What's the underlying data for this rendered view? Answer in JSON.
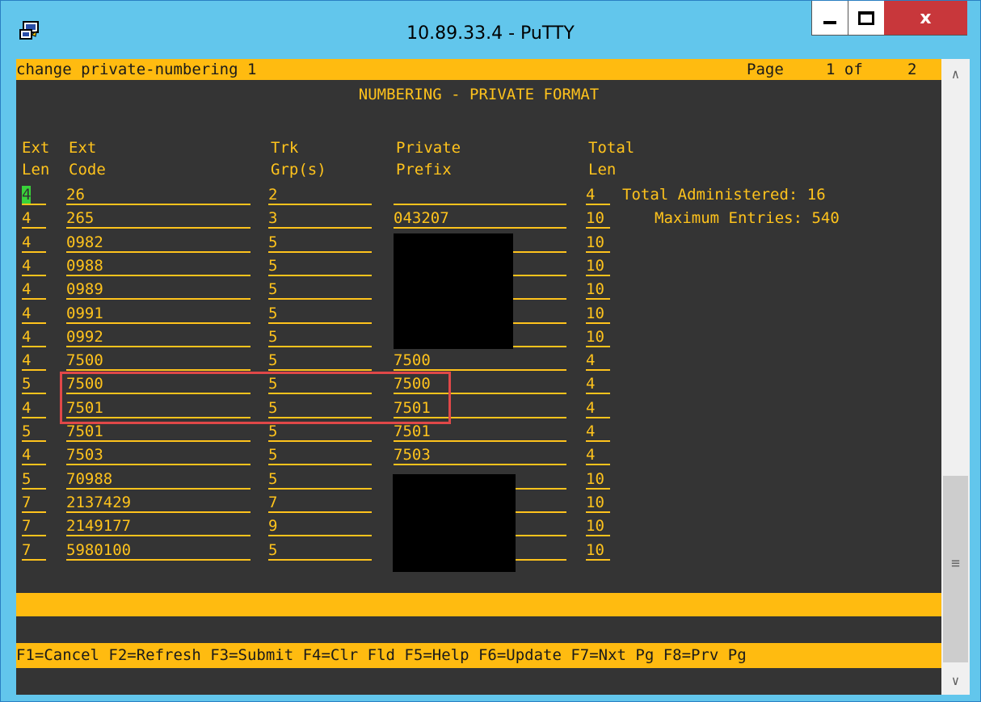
{
  "window": {
    "title": "10.89.33.4 - PuTTY",
    "close_label": "x"
  },
  "terminal": {
    "command": "change private-numbering 1",
    "page_label": "Page",
    "page_current": "1 of",
    "page_total": "2",
    "form_title": "NUMBERING - PRIVATE FORMAT",
    "col_headers": {
      "ext_len_1": "Ext",
      "ext_len_2": "Len",
      "ext_code_1": "Ext",
      "ext_code_2": "Code",
      "trk_1": "Trk",
      "trk_2": "Grp(s)",
      "prefix_1": "Private",
      "prefix_2": "Prefix",
      "total_1": "Total",
      "total_2": "Len"
    },
    "rows": [
      {
        "len": "4",
        "code": "26",
        "trk": "2",
        "prefix": "",
        "total": "4"
      },
      {
        "len": "4",
        "code": "265",
        "trk": "3",
        "prefix": "043207",
        "total": "10"
      },
      {
        "len": "4",
        "code": "0982",
        "trk": "5",
        "prefix": "",
        "total": "10"
      },
      {
        "len": "4",
        "code": "0988",
        "trk": "5",
        "prefix": "",
        "total": "10"
      },
      {
        "len": "4",
        "code": "0989",
        "trk": "5",
        "prefix": "",
        "total": "10"
      },
      {
        "len": "4",
        "code": "0991",
        "trk": "5",
        "prefix": "",
        "total": "10"
      },
      {
        "len": "4",
        "code": "0992",
        "trk": "5",
        "prefix": "",
        "total": "10"
      },
      {
        "len": "4",
        "code": "7500",
        "trk": "5",
        "prefix": "7500",
        "total": "4"
      },
      {
        "len": "5",
        "code": "7500",
        "trk": "5",
        "prefix": "7500",
        "total": "4"
      },
      {
        "len": "4",
        "code": "7501",
        "trk": "5",
        "prefix": "7501",
        "total": "4"
      },
      {
        "len": "5",
        "code": "7501",
        "trk": "5",
        "prefix": "7501",
        "total": "4"
      },
      {
        "len": "4",
        "code": "7503",
        "trk": "5",
        "prefix": "7503",
        "total": "4"
      },
      {
        "len": "5",
        "code": "70988",
        "trk": "5",
        "prefix": "",
        "total": "10"
      },
      {
        "len": "7",
        "code": "2137429",
        "trk": "7",
        "prefix": "",
        "total": "10"
      },
      {
        "len": "7",
        "code": "2149177",
        "trk": "9",
        "prefix": "",
        "total": "10"
      },
      {
        "len": "7",
        "code": "5980100",
        "trk": "5",
        "prefix": "",
        "total": "10"
      }
    ],
    "total_administered": "Total Administered: 16",
    "maximum_entries": "Maximum Entries: 540",
    "function_keys": "F1=Cancel F2=Refresh F3=Submit F4=Clr Fld F5=Help F6=Update F7=Nxt Pg F8=Prv Pg"
  },
  "icons": {
    "app": "putty-icon",
    "minimize": "minimize-icon",
    "maximize": "maximize-icon",
    "close": "close-icon",
    "scroll_up": "chevron-up-icon",
    "scroll_down": "chevron-down-icon"
  },
  "colors": {
    "terminal_bg": "#343434",
    "field_text": "#ffc31c",
    "bar_yellow": "#ffbb10",
    "cursor_green": "#39d33a",
    "highlight_red": "#e04848",
    "titlebar": "#62c6ec"
  }
}
